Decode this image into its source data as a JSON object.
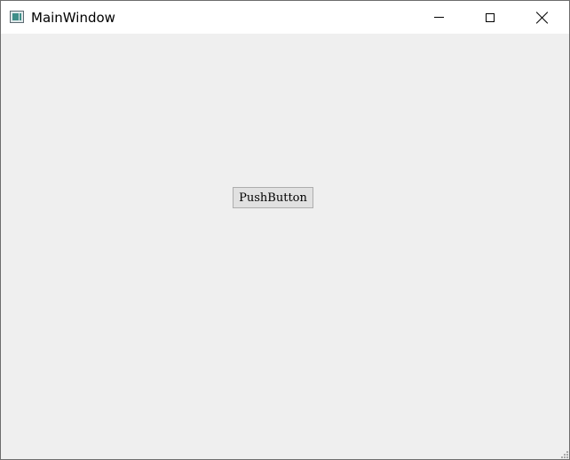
{
  "window": {
    "title": "MainWindow",
    "app_icon": "window-app-icon",
    "controls": {
      "minimize_icon": "minimize-icon",
      "maximize_icon": "maximize-icon",
      "close_icon": "close-icon"
    }
  },
  "content": {
    "push_button_label": "PushButton"
  },
  "colors": {
    "client_background": "#efefef",
    "titlebar_background": "#ffffff",
    "button_background": "#e1e1e1",
    "button_border": "#adadad"
  }
}
